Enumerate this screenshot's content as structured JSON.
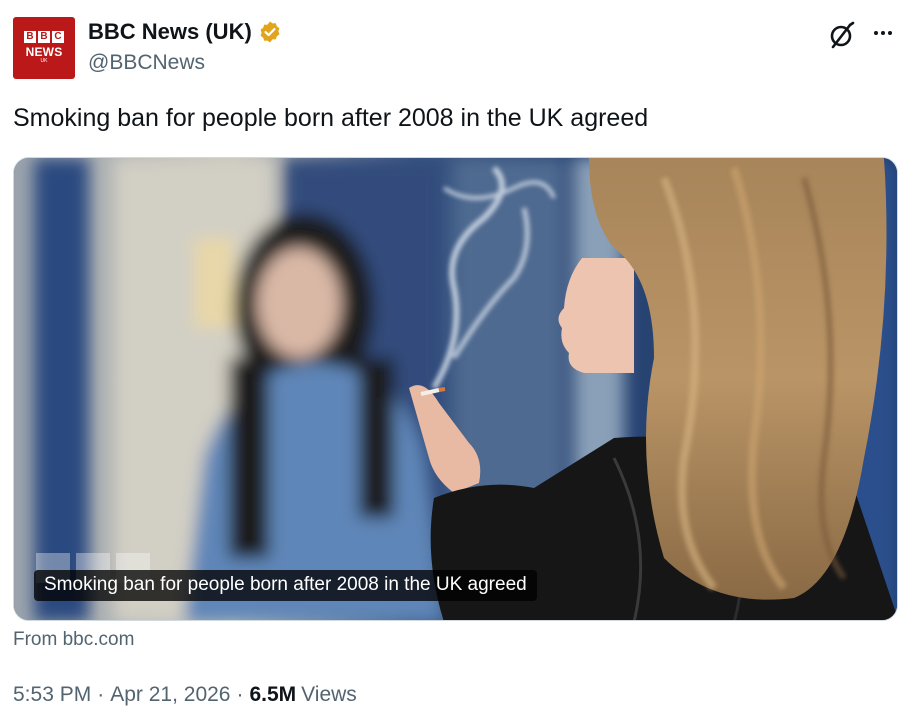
{
  "author": {
    "display_name": "BBC News (UK)",
    "handle": "@BBCNews",
    "avatar": {
      "block_letters": [
        "B",
        "B",
        "C"
      ],
      "word": "NEWS",
      "sub": "UK",
      "color": "#bb1919"
    },
    "verified_color": "#e2a41b"
  },
  "tweet": {
    "text": "Smoking ban for people born after 2008 in the UK agreed"
  },
  "card": {
    "caption": "Smoking ban for people born after 2008 in the UK agreed",
    "source": "From bbc.com"
  },
  "meta": {
    "time": "5:53 PM",
    "date": "Apr 21, 2026",
    "separator": "·",
    "views_count": "6.5M",
    "views_label": "Views"
  },
  "icons": {
    "grok": "grok-icon",
    "more": "more-options-icon",
    "verified": "verified-badge-icon"
  }
}
